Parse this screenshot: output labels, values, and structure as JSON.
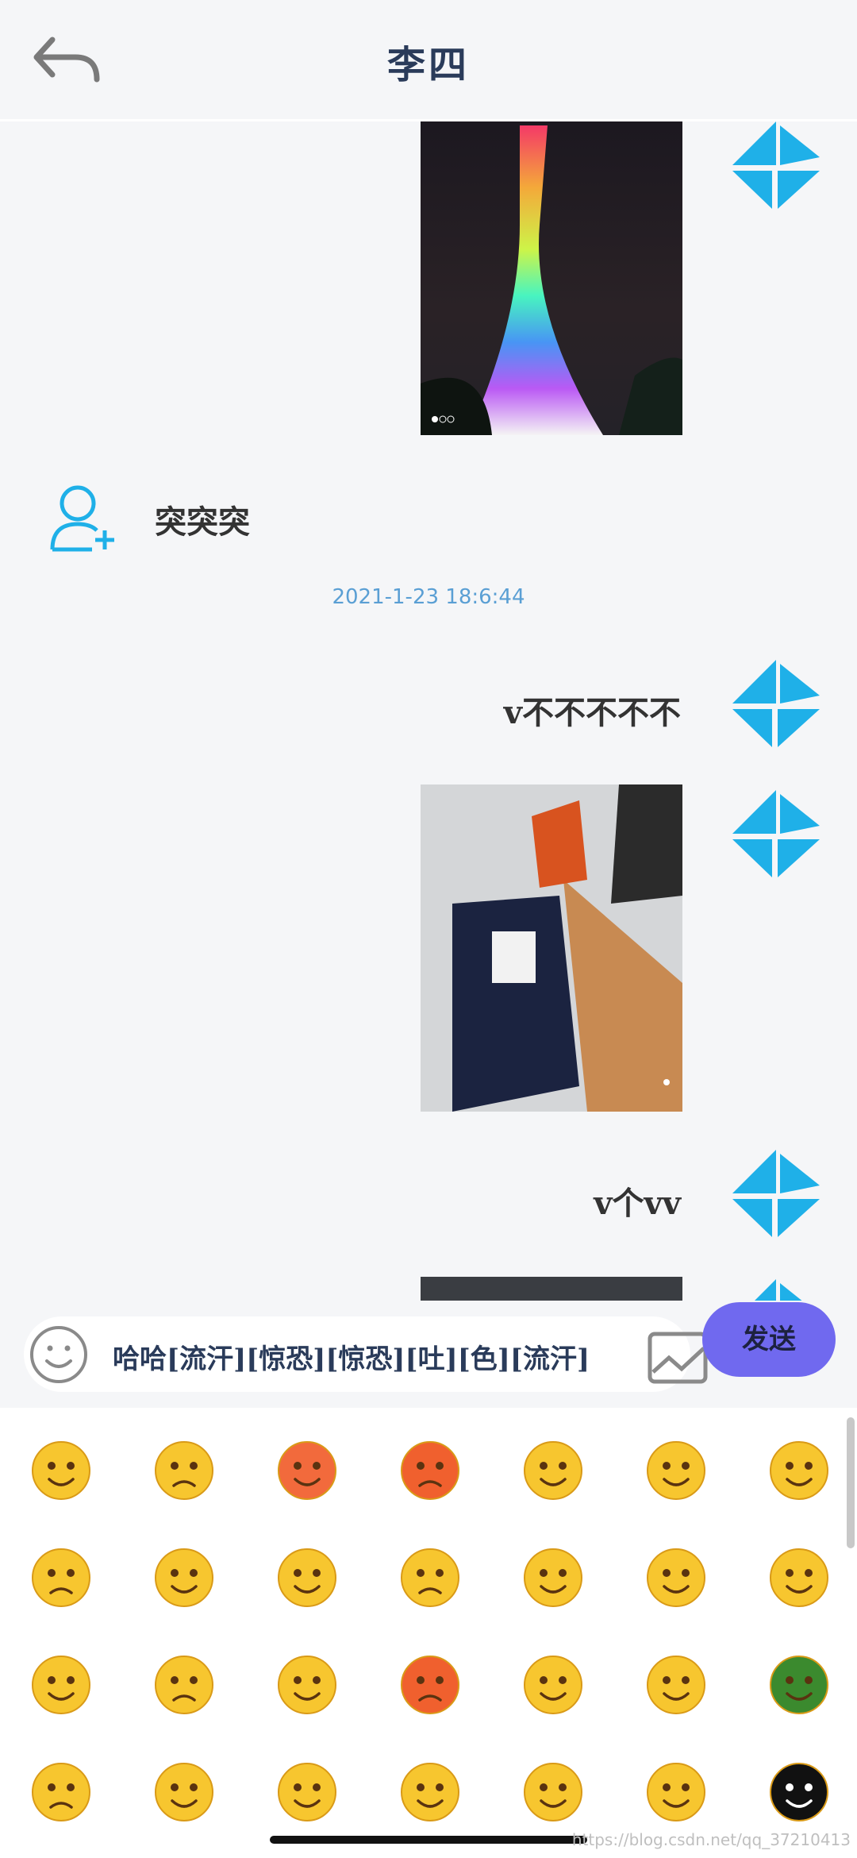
{
  "header": {
    "title": "李四",
    "back_icon": "back-arrow-icon"
  },
  "messages": [
    {
      "type": "image",
      "side": "right",
      "alt": "canton-tower-photo"
    },
    {
      "type": "text",
      "side": "left",
      "text": "突突突"
    },
    {
      "type": "timestamp",
      "text": "2021-1-23 18:6:44"
    },
    {
      "type": "text",
      "side": "right",
      "text": "v不不不不不"
    },
    {
      "type": "image",
      "side": "right",
      "alt": "office-photo"
    },
    {
      "type": "text",
      "side": "right",
      "text": "v个vv"
    },
    {
      "type": "image",
      "side": "right",
      "alt": "screen-photo"
    }
  ],
  "composer": {
    "input_value": "哈哈[流汗][惊恐][惊恐][吐][色][流汗]",
    "send_label": "发送",
    "emoji_icon": "smiley-icon",
    "image_icon": "image-icon"
  },
  "emoji_panel": {
    "rows": [
      [
        "smile",
        "worried",
        "blush-red",
        "angry",
        "tongue-wink",
        "grin",
        "shocked"
      ],
      [
        "sad",
        "shy",
        "scream",
        "sick",
        "heart-eyes",
        "cover-mouth",
        "happy"
      ],
      [
        "surprised",
        "confused",
        "roll-eyes",
        "furious",
        "sweat",
        "laugh",
        "army-helmet"
      ],
      [
        "mad",
        "bandana",
        "sneer",
        "question",
        "shh",
        "dizzy",
        "bug"
      ]
    ]
  },
  "watermark": "https://blog.csdn.net/qq_37210413",
  "colors": {
    "accent": "#7069ef",
    "avatar_blue": "#1fb0e8",
    "timestamp": "#5a9fd4"
  }
}
